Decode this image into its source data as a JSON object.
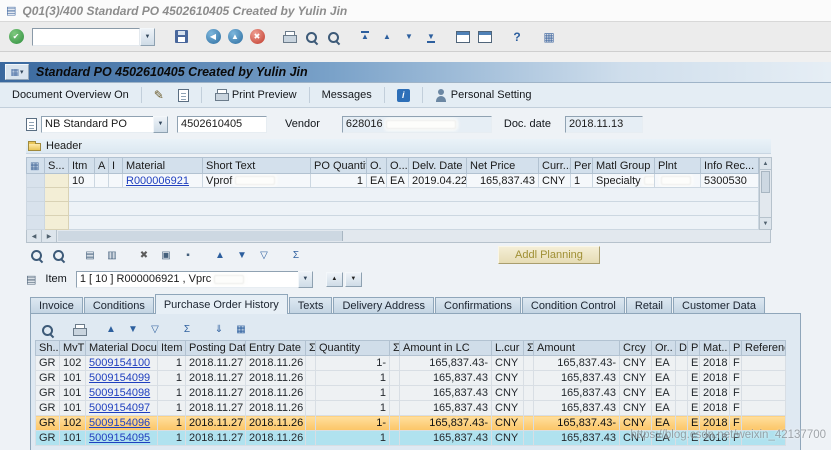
{
  "window": {
    "title": "Q01(3)/400 Standard PO 4502610405 Created by Yulin Jin"
  },
  "std_toolbar": {
    "command_value": "",
    "icons": [
      {
        "name": "save-icon",
        "icls": "i-save",
        "glyph": "",
        "sp": "sp"
      },
      {
        "name": "back-icon",
        "icls": "gc gc-teal",
        "glyph": "◀",
        "sp": "sp"
      },
      {
        "name": "exit-icon",
        "icls": "gc gc-teal",
        "glyph": "▲",
        "sp": ""
      },
      {
        "name": "cancel-icon",
        "icls": "gc gc-red",
        "glyph": "✖",
        "sp": ""
      },
      {
        "name": "print-icon",
        "icls": "i-print",
        "glyph": "",
        "sp": "sp"
      },
      {
        "name": "find-icon",
        "icls": "i-mag",
        "glyph": "",
        "sp": ""
      },
      {
        "name": "find-next-icon",
        "icls": "i-mag",
        "glyph": "",
        "sp": ""
      },
      {
        "name": "first-page-icon",
        "icls": "pg pg-first",
        "glyph": "▲",
        "sp": "sp"
      },
      {
        "name": "previous-page-icon",
        "icls": "pg",
        "glyph": "▲",
        "sp": ""
      },
      {
        "name": "next-page-icon",
        "icls": "pg",
        "glyph": "▼",
        "sp": ""
      },
      {
        "name": "last-page-icon",
        "icls": "pg pg-last",
        "glyph": "▼",
        "sp": ""
      },
      {
        "name": "new-session-icon",
        "icls": "i-win",
        "glyph": "",
        "sp": "sp"
      },
      {
        "name": "create-shortcut-icon",
        "icls": "i-win",
        "glyph": "",
        "sp": ""
      },
      {
        "name": "help-icon",
        "icls": "q-help",
        "glyph": "?",
        "sp": "sp"
      },
      {
        "name": "customize-layout-icon",
        "icls": "i-gridico",
        "glyph": "▦",
        "sp": "sp"
      }
    ]
  },
  "app": {
    "title": "Standard PO 4502610405 Created by Yulin Jin"
  },
  "app_toolbar": {
    "document_overview": "Document Overview On",
    "print_preview": "Print Preview",
    "messages": "Messages",
    "personal_setting": "Personal Setting"
  },
  "doc_header": {
    "order_type": "NB Standard PO",
    "po_number": "4502610405",
    "vendor_label": "Vendor",
    "vendor_value": "628016",
    "doc_date_label": "Doc. date",
    "doc_date_value": "2018.11.13"
  },
  "header_section": {
    "label": "Header"
  },
  "item_grid": {
    "columns": [
      "S...",
      "Itm",
      "A",
      "I",
      "Material",
      "Short Text",
      "PO Quantity",
      "O.",
      "O...",
      "Delv. Date",
      "Net Price",
      "Curr...",
      "Per",
      "Matl Group",
      "Plnt",
      "Info Rec..."
    ],
    "row": {
      "itm": "10",
      "material": "R000006921",
      "short_text": "Vprof",
      "po_quantity": "1",
      "ou1": "EA",
      "ou2": "EA",
      "delv_date": "2019.04.22",
      "net_price": "165,837.43",
      "curr": "CNY",
      "per": "1",
      "matl_group": "Specialty",
      "info_rec": "5300530"
    }
  },
  "grid_toolbar": {
    "icons": [
      {
        "name": "search-icon",
        "icls": "i-mag",
        "glyph": "",
        "sp": ""
      },
      {
        "name": "search-next-icon",
        "icls": "i-mag",
        "glyph": "",
        "sp": ""
      },
      {
        "name": "item-details-icon",
        "icls": "gi",
        "glyph": "▤",
        "sp": "sp"
      },
      {
        "name": "item-overview-icon",
        "icls": "gi",
        "glyph": "▥",
        "sp": ""
      },
      {
        "name": "delete-item-icon",
        "icls": "gi gi-dark",
        "glyph": "✖",
        "sp": "sp"
      },
      {
        "name": "duplicate-item-icon",
        "icls": "gi",
        "glyph": "▣",
        "sp": ""
      },
      {
        "name": "lock-item-icon",
        "icls": "gi",
        "glyph": "▪",
        "sp": ""
      },
      {
        "name": "sort-ascending-icon",
        "icls": "gi gi-blue",
        "glyph": "▲",
        "sp": "sp"
      },
      {
        "name": "sort-descending-icon",
        "icls": "gi gi-blue",
        "glyph": "▼",
        "sp": ""
      },
      {
        "name": "filter-icon",
        "icls": "gi gi-blue",
        "glyph": "▽",
        "sp": ""
      },
      {
        "name": "subtotal-icon",
        "icls": "gi gi-blue",
        "glyph": "Σ",
        "sp": "sp"
      }
    ],
    "addl_planning": "Addl Planning"
  },
  "item_selector": {
    "label": "Item",
    "value": "1 [ 10 ] R000006921 , Vprc"
  },
  "tabs": {
    "items": [
      {
        "label": "Invoice",
        "cls": ""
      },
      {
        "label": "Conditions",
        "cls": ""
      },
      {
        "label": "Purchase Order History",
        "cls": "active"
      },
      {
        "label": "Texts",
        "cls": ""
      },
      {
        "label": "Delivery Address",
        "cls": ""
      },
      {
        "label": "Confirmations",
        "cls": ""
      },
      {
        "label": "Condition Control",
        "cls": ""
      },
      {
        "label": "Retail",
        "cls": ""
      },
      {
        "label": "Customer Data",
        "cls": ""
      }
    ]
  },
  "history": {
    "toolbar_icons": [
      {
        "name": "details-icon",
        "icls": "i-mag",
        "glyph": "",
        "sp": ""
      },
      {
        "name": "print-icon",
        "icls": "i-print",
        "glyph": "",
        "sp": "sp"
      },
      {
        "name": "sort-ascending-icon",
        "icls": "gi gi-blue",
        "glyph": "▲",
        "sp": "sp"
      },
      {
        "name": "sort-descending-icon",
        "icls": "gi gi-blue",
        "glyph": "▼",
        "sp": ""
      },
      {
        "name": "filter-icon",
        "icls": "gi gi-blue",
        "glyph": "▽",
        "sp": ""
      },
      {
        "name": "sum-icon",
        "icls": "gi gi-blue",
        "glyph": "Σ",
        "sp": "sp"
      },
      {
        "name": "export-icon",
        "icls": "gi gi-blue",
        "glyph": "⇓",
        "sp": "sp"
      },
      {
        "name": "layout-icon",
        "icls": "gi gi-blue",
        "glyph": "▦",
        "sp": ""
      }
    ],
    "columns": [
      "Sh..",
      "MvT",
      "Material Docu...",
      "Item",
      "Posting Date",
      "Entry Date",
      "Σ",
      "Quantity",
      "Σ",
      "Amount in LC",
      "L.cur",
      "Σ",
      "Amount",
      "Crcy",
      "Or..",
      "D",
      "P",
      "Mat..",
      "P",
      "Reference"
    ],
    "rows": [
      {
        "sh": "GR",
        "mvt": "102",
        "doc": "5009154100",
        "item": "1",
        "pdate": "2018.11.27",
        "edate": "2018.11.26",
        "qty": "1-",
        "amt_lc": "165,837.43-",
        "lcur": "CNY",
        "amt": "165,837.43-",
        "crcy": "CNY",
        "oun": "EA",
        "d": "",
        "p": "E",
        "mat": "2018",
        "p2": "F",
        "ref": "",
        "cls": ""
      },
      {
        "sh": "GR",
        "mvt": "101",
        "doc": "5009154099",
        "item": "1",
        "pdate": "2018.11.27",
        "edate": "2018.11.26",
        "qty": "1",
        "amt_lc": "165,837.43",
        "lcur": "CNY",
        "amt": "165,837.43",
        "crcy": "CNY",
        "oun": "EA",
        "d": "",
        "p": "E",
        "mat": "2018",
        "p2": "F",
        "ref": "",
        "cls": ""
      },
      {
        "sh": "GR",
        "mvt": "101",
        "doc": "5009154098",
        "item": "1",
        "pdate": "2018.11.27",
        "edate": "2018.11.26",
        "qty": "1",
        "amt_lc": "165,837.43",
        "lcur": "CNY",
        "amt": "165,837.43",
        "crcy": "CNY",
        "oun": "EA",
        "d": "",
        "p": "E",
        "mat": "2018",
        "p2": "F",
        "ref": "",
        "cls": ""
      },
      {
        "sh": "GR",
        "mvt": "101",
        "doc": "5009154097",
        "item": "1",
        "pdate": "2018.11.27",
        "edate": "2018.11.26",
        "qty": "1",
        "amt_lc": "165,837.43",
        "lcur": "CNY",
        "amt": "165,837.43",
        "crcy": "CNY",
        "oun": "EA",
        "d": "",
        "p": "E",
        "mat": "2018",
        "p2": "F",
        "ref": "",
        "cls": ""
      },
      {
        "sh": "GR",
        "mvt": "102",
        "doc": "5009154096",
        "item": "1",
        "pdate": "2018.11.27",
        "edate": "2018.11.26",
        "qty": "1-",
        "amt_lc": "165,837.43-",
        "lcur": "CNY",
        "amt": "165,837.43-",
        "crcy": "CNY",
        "oun": "EA",
        "d": "",
        "p": "E",
        "mat": "2018",
        "p2": "F",
        "ref": "",
        "cls": "row-sel"
      },
      {
        "sh": "GR",
        "mvt": "101",
        "doc": "5009154095",
        "item": "1",
        "pdate": "2018.11.27",
        "edate": "2018.11.26",
        "qty": "1",
        "amt_lc": "165,837.43",
        "lcur": "CNY",
        "amt": "165,837.43",
        "crcy": "CNY",
        "oun": "EA",
        "d": "",
        "p": "E",
        "mat": "2018",
        "p2": "F",
        "ref": "",
        "cls": "row-cyan"
      }
    ]
  },
  "watermark": {
    "text": "https://blog.csdn.net/weixin_42137700"
  },
  "colors": {
    "title_gradient_blue": "#39689e",
    "selected_row_orange": "#fbc566",
    "bottom_row_cyan": "#b0e2ef",
    "link_blue": "#1f3fbf",
    "status_cell_beige": "#f3eed6"
  }
}
